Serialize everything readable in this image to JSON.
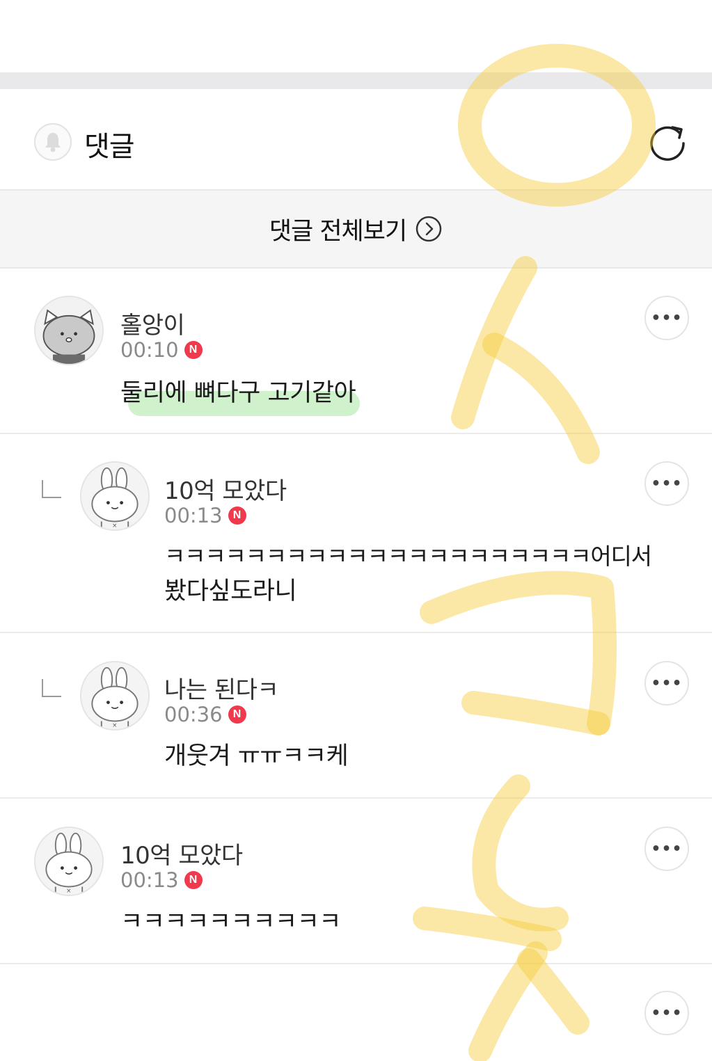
{
  "header": {
    "title": "댓글",
    "bell_icon": "bell-icon",
    "refresh_icon": "refresh-icon"
  },
  "view_all": {
    "label": "댓글 전체보기",
    "icon": "chevron-right-circle-icon"
  },
  "comments": [
    {
      "avatar": "cat-avatar",
      "nickname": "홀앙이",
      "time": "00:10",
      "badge": "N",
      "text": "둘리에 뼈다구 고기같아",
      "highlighted": true,
      "is_reply": false,
      "more_icon": "more-icon"
    },
    {
      "avatar": "rabbit-avatar",
      "nickname": "10억 모았다",
      "time": "00:13",
      "badge": "N",
      "text_line1": "ㅋㅋㅋㅋㅋㅋㅋㅋㅋㅋㅋㅋㅋㅋㅋㅋㅋㅋㅋㅋㅋ어디서",
      "text_line2": "봤다싶도라니",
      "is_reply": true,
      "more_icon": "more-icon"
    },
    {
      "avatar": "rabbit-avatar",
      "nickname": "나는 된다ㅋ",
      "time": "00:36",
      "badge": "N",
      "text": "개웃겨 ㅠㅠㅋㅋ케",
      "is_reply": true,
      "more_icon": "more-icon"
    },
    {
      "avatar": "rabbit-avatar",
      "nickname": "10억 모았다",
      "time": "00:13",
      "badge": "N",
      "text": "ㅋㅋㅋㅋㅋㅋㅋㅋㅋㅋ",
      "is_reply": false,
      "more_icon": "more-icon"
    }
  ],
  "overlay": {
    "description_color": "#f5c518"
  }
}
